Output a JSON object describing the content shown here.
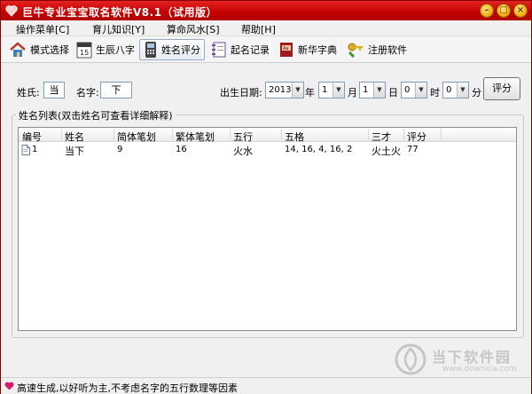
{
  "window": {
    "title": "巨牛专业宝宝取名软件V8.1（试用版）"
  },
  "menu": [
    {
      "label": "操作菜单[C]"
    },
    {
      "label": "育儿知识[Y]"
    },
    {
      "label": "算命风水[S]"
    },
    {
      "label": "帮助[H]"
    }
  ],
  "toolbar": [
    {
      "label": "模式选择",
      "icon": "home-icon"
    },
    {
      "label": "生辰八字",
      "icon": "calendar-icon"
    },
    {
      "label": "姓名评分",
      "icon": "phone-icon",
      "active": true
    },
    {
      "label": "起名记录",
      "icon": "notebook-icon"
    },
    {
      "label": "新华字典",
      "icon": "dictionary-icon"
    },
    {
      "label": "注册软件",
      "icon": "keys-icon"
    }
  ],
  "form": {
    "surname_label": "姓氏:",
    "surname_value": "当",
    "given_label": "名字:",
    "given_value": "下",
    "birth_label": "出生日期:",
    "year_value": "2013",
    "year_unit": "年",
    "month_value": "1",
    "month_unit": "月",
    "day_value": "1",
    "day_unit": "日",
    "hour_value": "0",
    "hour_unit": "时",
    "minute_value": "0",
    "minute_unit": "分",
    "score_button": "评分"
  },
  "name_list": {
    "title": "姓名列表(双击姓名可查看详细解释)",
    "columns": [
      "编号",
      "姓名",
      "简体笔划",
      "繁体笔划",
      "五行",
      "五格",
      "三才",
      "评分"
    ],
    "rows": [
      {
        "no": "1",
        "name": "当下",
        "simplified_strokes": "9",
        "traditional_strokes": "16",
        "wuxing": "火水",
        "wuge": "14, 16, 4, 16, 2",
        "sancai": "火土火",
        "score": "77"
      }
    ]
  },
  "status": {
    "text": "高速生成,以好听为主,不考虑名字的五行数理等因素"
  },
  "watermark": {
    "brand": "当下软件园",
    "url": "www.downxia.com"
  }
}
